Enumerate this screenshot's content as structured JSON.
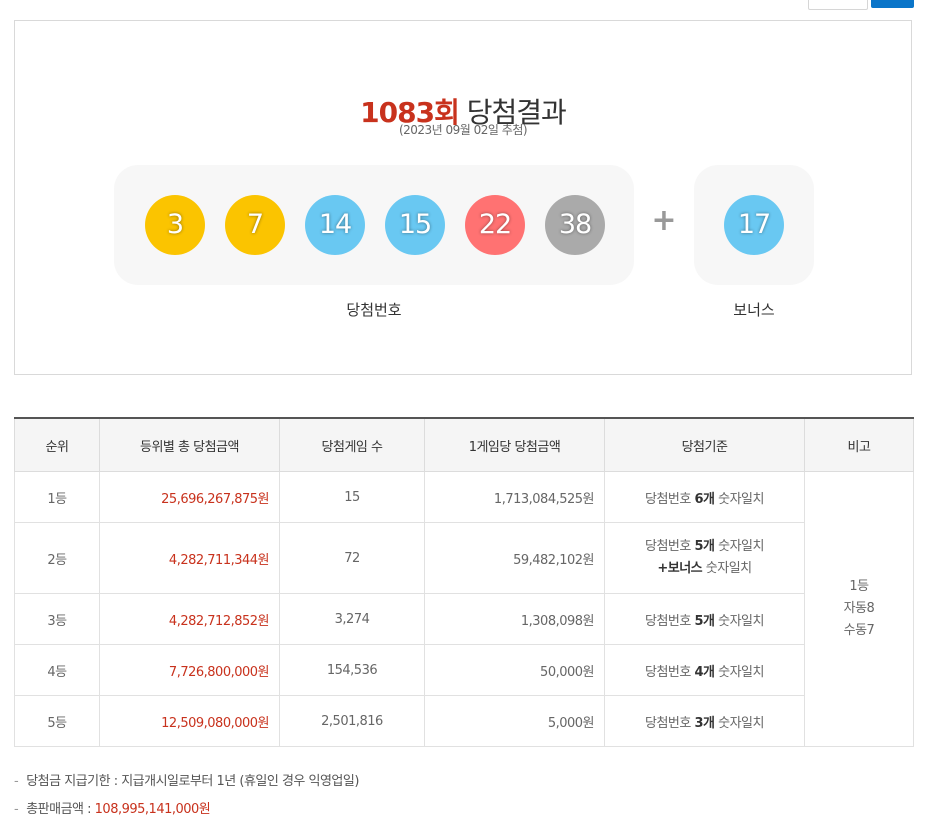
{
  "result": {
    "draw_no": "1083회",
    "title_suffix": " 당첨결과",
    "date": "(2023년 09월 02일 추첨)",
    "winning_numbers": [
      {
        "num": "3",
        "color": "#fbc400"
      },
      {
        "num": "7",
        "color": "#fbc400"
      },
      {
        "num": "14",
        "color": "#69c8f2"
      },
      {
        "num": "15",
        "color": "#69c8f2"
      },
      {
        "num": "22",
        "color": "#ff7272"
      },
      {
        "num": "38",
        "color": "#aaaaaa"
      }
    ],
    "plus_symbol": "+",
    "bonus": {
      "num": "17",
      "color": "#69c8f2"
    },
    "winning_caption": "당첨번호",
    "bonus_caption": "보너스"
  },
  "table": {
    "headers": [
      "순위",
      "등위별 총 당첨금액",
      "당첨게임 수",
      "1게임당 당첨금액",
      "당첨기준",
      "비고"
    ],
    "rows": [
      {
        "rank": "1등",
        "total": "25,696,267,875원",
        "count": "15",
        "per_game": "1,713,084,525원",
        "criteria_pre": "당첨번호 ",
        "criteria_bold": "6개",
        "criteria_post": " 숫자일치"
      },
      {
        "rank": "2등",
        "total": "4,282,711,344원",
        "count": "72",
        "per_game": "59,482,102원",
        "criteria_pre": "당첨번호 ",
        "criteria_bold": "5개",
        "criteria_post": " 숫자일치",
        "criteria2_pre": "+",
        "criteria2_bold": "보너스",
        "criteria2_post": " 숫자일치"
      },
      {
        "rank": "3등",
        "total": "4,282,712,852원",
        "count": "3,274",
        "per_game": "1,308,098원",
        "criteria_pre": "당첨번호 ",
        "criteria_bold": "5개",
        "criteria_post": " 숫자일치"
      },
      {
        "rank": "4등",
        "total": "7,726,800,000원",
        "count": "154,536",
        "per_game": "50,000원",
        "criteria_pre": "당첨번호 ",
        "criteria_bold": "4개",
        "criteria_post": " 숫자일치"
      },
      {
        "rank": "5등",
        "total": "12,509,080,000원",
        "count": "2,501,816",
        "per_game": "5,000원",
        "criteria_pre": "당첨번호 ",
        "criteria_bold": "3개",
        "criteria_post": " 숫자일치"
      }
    ],
    "note": {
      "line1": "1등",
      "line2": "자동8",
      "line3": "수동7"
    }
  },
  "footnotes": {
    "dash": "-",
    "deadline_label": "당첨금 지급기한 : ",
    "deadline_text": "지급개시일로부터 1년 (휴일인 경우 익영업일)",
    "sales_label": "총판매금액 : ",
    "sales_value": "108,995,141,000원"
  },
  "colors": {
    "accent_red": "#c8321d",
    "button_blue": "#0a75c9"
  }
}
